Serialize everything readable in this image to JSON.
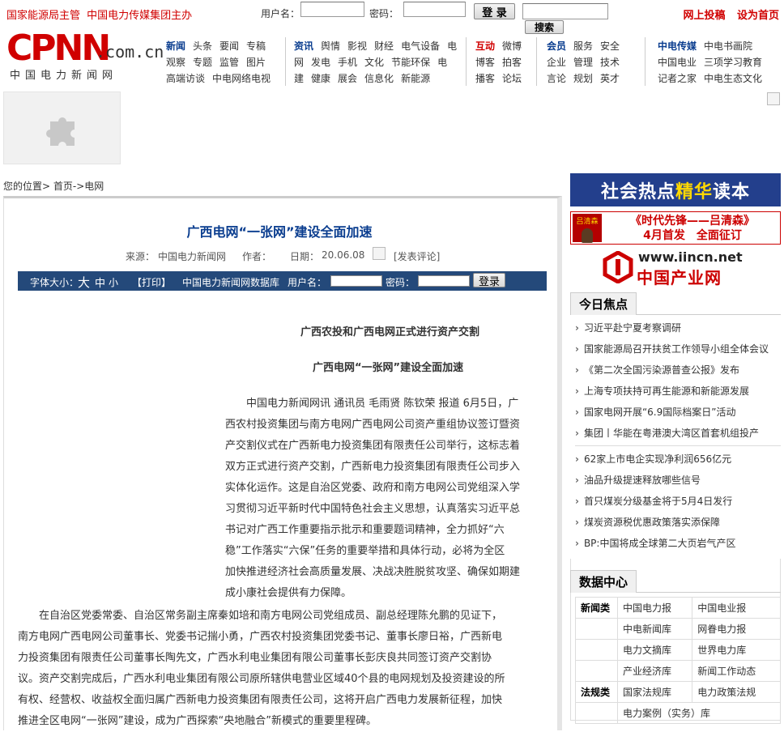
{
  "topbar": {
    "host_left": "国家能源局主管",
    "host_right": "中国电力传媒集团主办",
    "username_label": "用户名：",
    "password_label": "密码：",
    "login_button": "登 录",
    "search_button": "搜索",
    "submit_link": "网上投稿",
    "homepage_link": "设为首页"
  },
  "logo": {
    "mark": "CPNN",
    "domain": ".com.cn",
    "subtitle": "中国电力新闻网"
  },
  "nav": {
    "group1": [
      [
        "新闻",
        "头条",
        "要闻",
        "专稿"
      ],
      [
        "观察",
        "专题",
        "监管",
        "图片"
      ],
      [
        "高端访谈",
        "中电网络电视"
      ]
    ],
    "group2": [
      [
        "资讯",
        "舆情",
        "影视",
        "财经",
        "电气设备",
        "电"
      ],
      [
        "网",
        "发电",
        "手机",
        "文化",
        "节能环保",
        "电"
      ],
      [
        "建",
        "健康",
        "展会",
        "信息化",
        "新能源"
      ]
    ],
    "group3": [
      [
        "互动",
        "微博"
      ],
      [
        "博客",
        "拍客"
      ],
      [
        "播客",
        "论坛"
      ]
    ],
    "group4": [
      [
        "会员",
        "服务",
        "安全"
      ],
      [
        "企业",
        "管理",
        "技术"
      ],
      [
        "言论",
        "规划",
        "英才"
      ]
    ],
    "group5": [
      [
        "中电传媒",
        "中电书画院"
      ],
      [
        "中国电业",
        "三项学习教育"
      ],
      [
        "记者之家",
        "中电生态文化"
      ]
    ]
  },
  "breadcrumb": {
    "label": "您的位置>",
    "home": "首页",
    "arrow": "->",
    "section": "电网"
  },
  "article": {
    "title": "广西电网“一张网”建设全面加速",
    "source_label": "来源：",
    "source": "中国电力新闻网",
    "author_label": "作者：",
    "date_label": "日期：",
    "date": "20.06.08",
    "comment_link": "[发表评论]",
    "toolbar": {
      "font_size_label": "字体大小：",
      "font_big": "大",
      "font_mid": "中",
      "font_small": "小",
      "print": "【打印】",
      "database": "中国电力新闻网数据库",
      "username_label": "用户名：",
      "password_label": "密码：",
      "login": "登录"
    },
    "subtitle1": "广西农投和广西电网正式进行资产交割",
    "subtitle2": "广西电网“一张网”建设全面加速",
    "para1_lines": [
      "中国电力新闻网讯 通讯员 毛雨贤 陈钦荣 报道  6月5日，广",
      "西农村投资集团与南方电网广西电网公司资产重组协议签订暨资",
      "产交割仪式在广西新电力投资集团有限责任公司举行，这标志着",
      "双方正式进行资产交割，广西新电力投资集团有限责任公司步入",
      "实体化运作。这是自治区党委、政府和南方电网公司党组深入学",
      "习贯彻习近平新时代中国特色社会主义思想，认真落实习近平总",
      "书记对广西工作重要指示批示和重要题词精神，全力抓好“六",
      "稳”工作落实“六保”任务的重要举措和具体行动，必将为全区",
      "加快推进经济社会高质量发展、决战决胜脱贫攻坚、确保如期建",
      "成小康社会提供有力保障。"
    ],
    "para2_lines": [
      "在自治区党委常委、自治区常务副主席秦如培和南方电网公司党组成员、副总经理陈允鹏的见证下，",
      "南方电网广西电网公司董事长、党委书记揣小勇，广西农村投资集团党委书记、董事长廖日裕，广西新电",
      "力投资集团有限责任公司董事长陶先文，广西水利电业集团有限公司董事长彭庆良共同签订资产交割协",
      "议。资产交割完成后，广西水利电业集团有限公司原所辖供电营业区域40个县的电网规划及投资建设的所",
      "有权、经营权、收益权全面归属广西新电力投资集团有限责任公司，这将开启广西电力发展新征程，加快",
      "推进全区电网“一张网”建设，成为广西探索“央地融合”新模式的重要里程碑。"
    ]
  },
  "sidebar": {
    "ad1": {
      "part1": "社会热点",
      "part2": "精华",
      "part3": "读本"
    },
    "ad2": {
      "name_tag": "吕清森",
      "line1": "《时代先锋——吕清森》",
      "line2": "4月首发　全面征订"
    },
    "ad3": {
      "url": "www.iincn.net",
      "name": "中国产业网"
    },
    "focus_title": "今日焦点",
    "focus_group1": [
      "习近平赴宁夏考察调研",
      "国家能源局召开扶贫工作领导小组全体会议",
      "《第二次全国污染源普查公报》发布",
      "上海专项扶持可再生能源和新能源发展",
      "国家电网开展“6.9国际档案日”活动",
      "集团丨华能在粤港澳大湾区首套机组投产"
    ],
    "focus_group2": [
      "62家上市电企实现净利润656亿元",
      "油品升级提速释放哪些信号",
      "首只煤炭分级基金将于5月4日发行",
      "煤炭资源税优惠政策落实添保障",
      "BP:中国将成全球第二大页岩气产区"
    ],
    "data_title": "数据中心",
    "data_rows": [
      [
        "新闻类",
        "中国电力报",
        "中国电业报"
      ],
      [
        "",
        "中电新闻库",
        "网眷电力报"
      ],
      [
        "",
        "电力文摘库",
        "世界电力库"
      ],
      [
        "",
        "产业经济库",
        "新闻工作动态"
      ],
      [
        "法规类",
        "国家法规库",
        "电力政策法规"
      ],
      [
        "",
        "电力案例（实务）库",
        ""
      ]
    ]
  }
}
